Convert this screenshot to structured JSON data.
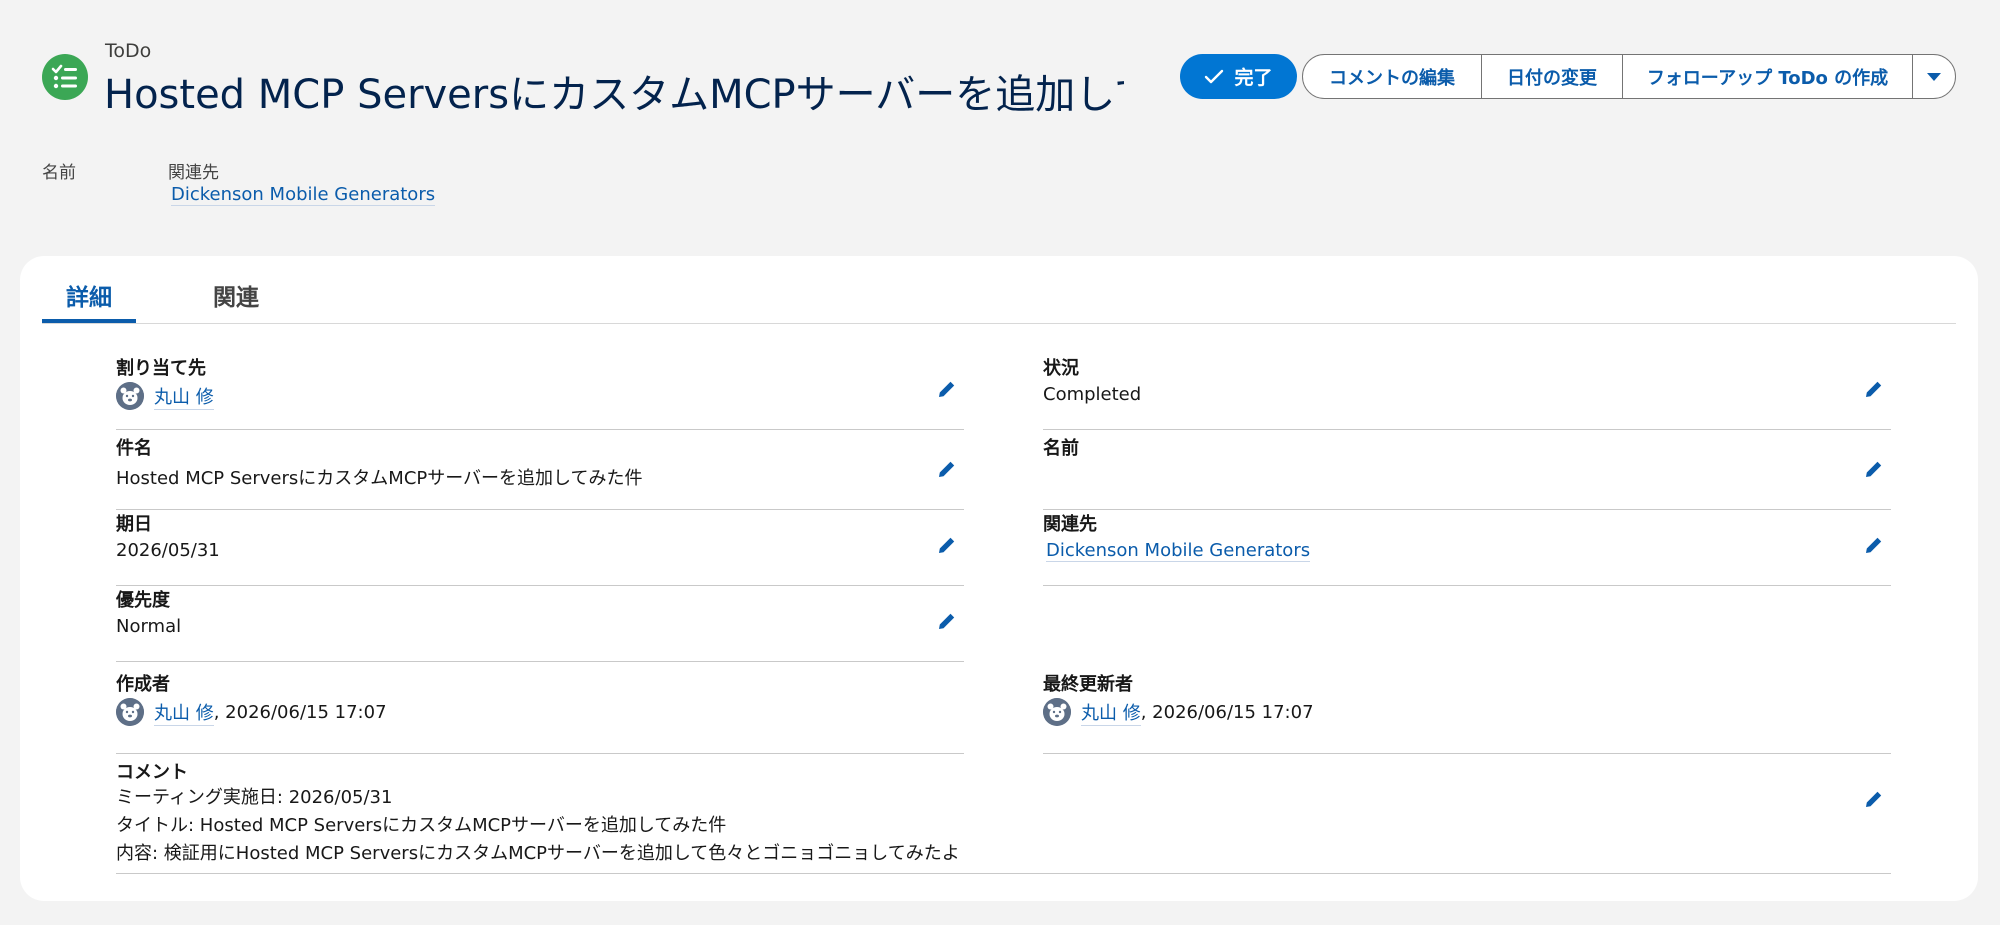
{
  "header": {
    "object_type": "ToDo",
    "title": "Hosted MCP ServersにカスタムMCPサーバーを追加して…",
    "icon": "task-checklist-icon",
    "icon_color": "#3ba755"
  },
  "actions": {
    "complete_label": "完了",
    "edit_comment": "コメントの編集",
    "change_date": "日付の変更",
    "create_followup": "フォローアップ ToDo の作成",
    "accent": "#0176d3"
  },
  "highlights": {
    "name_label": "名前",
    "related_label": "関連先",
    "related_value": "Dickenson Mobile Generators"
  },
  "tabs": {
    "details": "詳細",
    "related": "関連"
  },
  "fields": {
    "assigned_to": {
      "label": "割り当て先",
      "value": "丸山 修"
    },
    "status": {
      "label": "状況",
      "value": "Completed"
    },
    "subject": {
      "label": "件名",
      "value": "Hosted MCP ServersにカスタムMCPサーバーを追加してみた件"
    },
    "name": {
      "label": "名前",
      "value": ""
    },
    "due_date": {
      "label": "期日",
      "value": "2026/05/31"
    },
    "related_to": {
      "label": "関連先",
      "value": "Dickenson Mobile Generators"
    },
    "priority": {
      "label": "優先度",
      "value": "Normal"
    },
    "created_by": {
      "label": "作成者",
      "user": "丸山 修",
      "datetime": ", 2026/06/15 17:07"
    },
    "last_modified_by": {
      "label": "最終更新者",
      "user": "丸山 修",
      "datetime": ", 2026/06/15 17:07"
    },
    "comments": {
      "label": "コメント",
      "lines": [
        "ミーティング実施日: 2026/05/31",
        "タイトル: Hosted MCP ServersにカスタムMCPサーバーを追加してみた件",
        "内容: 検証用にHosted MCP ServersにカスタムMCPサーバーを追加して色々とゴニョゴニョしてみたよ"
      ]
    }
  }
}
